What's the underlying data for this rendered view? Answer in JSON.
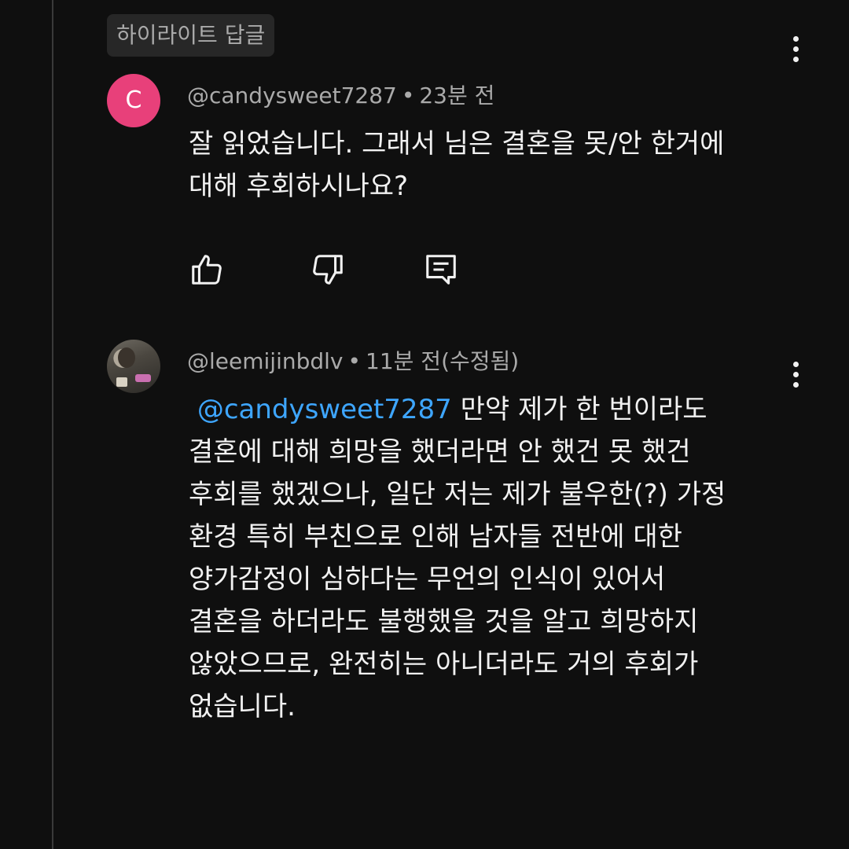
{
  "highlight_label": "하이라이트 답글",
  "comments": [
    {
      "avatar_letter": "C",
      "avatar_color": "#e8407a",
      "author": "@candysweet7287",
      "separator": "•",
      "time": "23분 전",
      "body_lines": [
        "잘 읽었습니다. 그래서 님은 결혼을 못/안 한거에",
        "대해 후회하시나요?"
      ],
      "actions": [
        "like-icon",
        "dislike-icon",
        "reply-icon"
      ]
    },
    {
      "author": "@leemijinbdlv",
      "separator": "•",
      "time": "11분 전(수정됨)",
      "mention": "@candysweet7287",
      "first_line_rest": " 만약 제가 한 번이라도",
      "body_lines": [
        "결혼에 대해 희망을 했더라면 안 했건 못 했건",
        "후회를 했겠으나, 일단 저는 제가 불우한(?) 가정",
        "환경 특히 부친으로 인해 남자들 전반에 대한",
        "양가감정이 심하다는 무언의 인식이 있어서",
        "결혼을 하더라도 불행했을 것을 알고 희망하지",
        "않았으므로, 완전히는 아니더라도 거의 후회가",
        "없습니다."
      ]
    }
  ],
  "colors": {
    "background": "#0f0f0f",
    "text": "#f1f1f1",
    "secondary_text": "#aaaaaa",
    "mention": "#3ea6ff",
    "badge_bg": "#272727"
  }
}
